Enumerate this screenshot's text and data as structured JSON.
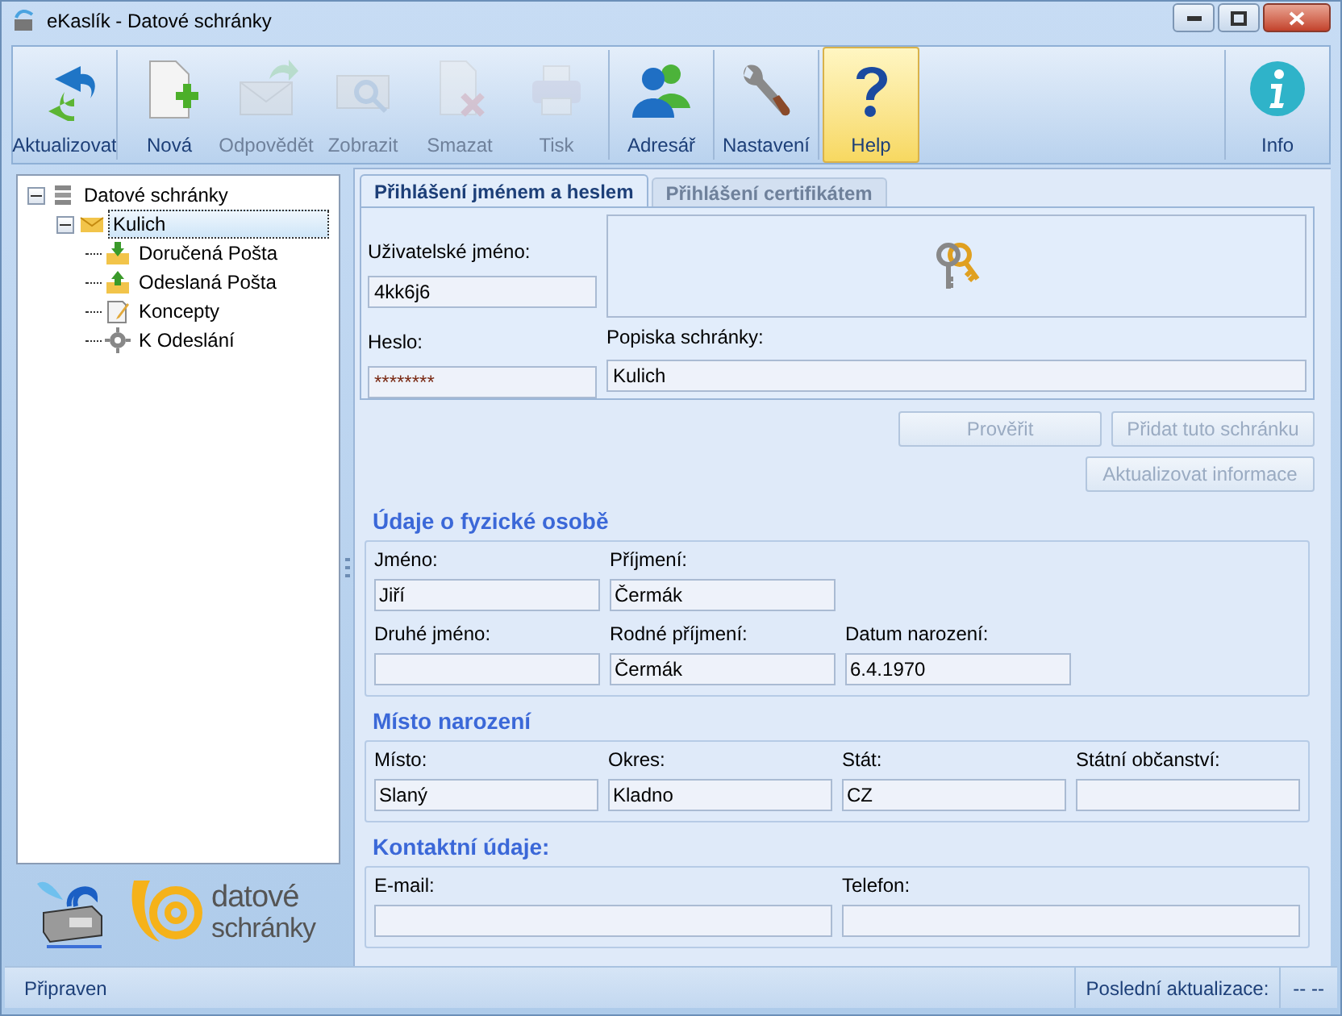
{
  "window": {
    "title": "eKaslík - Datové schránky"
  },
  "toolbar": {
    "groups": [
      [
        {
          "label": "Aktualizovat",
          "kind": "refresh",
          "disabled": false,
          "selected": false
        }
      ],
      [
        {
          "label": "Nová",
          "kind": "new",
          "disabled": false,
          "selected": false
        },
        {
          "label": "Odpovědět",
          "kind": "reply",
          "disabled": true,
          "selected": false
        },
        {
          "label": "Zobrazit",
          "kind": "view",
          "disabled": true,
          "selected": false
        },
        {
          "label": "Smazat",
          "kind": "delete",
          "disabled": true,
          "selected": false
        },
        {
          "label": "Tisk",
          "kind": "print",
          "disabled": true,
          "selected": false
        }
      ],
      [
        {
          "label": "Adresář",
          "kind": "contacts",
          "disabled": false,
          "selected": false
        }
      ],
      [
        {
          "label": "Nastavení",
          "kind": "settings",
          "disabled": false,
          "selected": false
        }
      ],
      [
        {
          "label": "Help",
          "kind": "help",
          "disabled": false,
          "selected": true
        }
      ]
    ],
    "right": [
      {
        "label": "Info",
        "kind": "info",
        "disabled": false,
        "selected": false
      }
    ]
  },
  "tree": [
    {
      "label": "Datové schránky",
      "kind": "database",
      "expanded": true,
      "selected": false,
      "children": [
        {
          "label": "Kulich",
          "kind": "mailbox",
          "expanded": true,
          "selected": true,
          "children": [
            {
              "label": "Doručená Pošta",
              "kind": "inbox",
              "selected": false
            },
            {
              "label": "Odeslaná Pošta",
              "kind": "outbox",
              "selected": false
            },
            {
              "label": "Koncepty",
              "kind": "draft",
              "selected": false
            },
            {
              "label": "K Odeslání",
              "kind": "gear",
              "selected": false
            }
          ]
        }
      ]
    }
  ],
  "logo": {
    "line_1": "datové",
    "line_2": "schránky"
  },
  "tabs": [
    {
      "label": "Přihlášení jménem a heslem",
      "selected": true
    },
    {
      "label": "Přihlášení certifikátem",
      "selected": false
    }
  ],
  "login": {
    "username": {
      "label": "Uživatelské jméno:",
      "value": "4kk6j6"
    },
    "password": {
      "label": "Heslo:",
      "value": "********"
    },
    "description": {
      "label": "Popiska schránky:",
      "value": "Kulich"
    }
  },
  "buttons": [
    {
      "label": "Prověřit",
      "disabled": true
    },
    {
      "label": "Přidat tuto schránku",
      "disabled": true
    },
    {
      "label": "Aktualizovat informace",
      "disabled": true
    }
  ],
  "sections": [
    {
      "title": "Údaje o fyzické osobě",
      "rows": [
        [
          {
            "label": "Jméno:",
            "value": "Jiří",
            "kind": "normal"
          },
          {
            "label": "Příjmení:",
            "value": "Čermák",
            "kind": "normal"
          }
        ],
        [
          {
            "label": "Druhé jméno:",
            "kind": "normal"
          },
          {
            "label": "Rodné příjmení:",
            "value": "Čermák",
            "kind": "normal"
          },
          {
            "label": "Datum narození:",
            "value": "6.4.1970",
            "kind": "normal"
          }
        ]
      ]
    },
    {
      "title": "Místo narození",
      "rows": [
        [
          {
            "label": "Místo:",
            "value": "Slaný",
            "kind": "normal"
          },
          {
            "label": "Okres:",
            "value": "Kladno",
            "kind": "normal"
          },
          {
            "label": "Stát:",
            "value": "CZ",
            "kind": "normal"
          },
          {
            "label": "Státní občanství:",
            "kind": "normal"
          }
        ]
      ]
    },
    {
      "title": "Kontaktní údaje:",
      "rows": [
        [
          {
            "label": "E-mail:",
            "kind": "wide"
          },
          {
            "label": "Telefon:",
            "kind": "wide"
          }
        ]
      ]
    }
  ],
  "status_bar": {
    "left": "Připraven",
    "last_update_label": "Poslední aktualizace:",
    "last_update_value": "-- --"
  }
}
